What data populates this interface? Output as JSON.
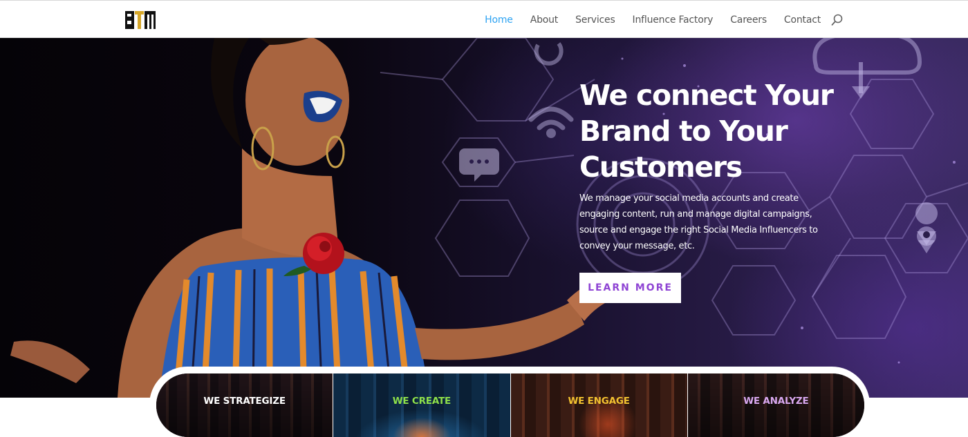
{
  "header": {
    "logo_text": "BTM",
    "nav": [
      {
        "label": "Home",
        "active": true
      },
      {
        "label": "About",
        "active": false
      },
      {
        "label": "Services",
        "active": false
      },
      {
        "label": "Influence Factory",
        "active": false
      },
      {
        "label": "Careers",
        "active": false
      },
      {
        "label": "Contact",
        "active": false
      }
    ],
    "search_icon": "search-icon",
    "active_color": "#2ea3f2"
  },
  "hero": {
    "title": "We connect Your Brand to Your Customers",
    "description": "We manage your social media accounts and create engaging content, run and manage digital campaigns, source and engage the right Social Media Influencers to convey your message, etc.",
    "cta_label": "LEARN MORE",
    "cta_color": "#8f45d4"
  },
  "features": [
    {
      "label": "WE STRATEGIZE",
      "color": "#ffffff"
    },
    {
      "label": "WE CREATE",
      "color": "#8ee04a"
    },
    {
      "label": "WE ENGAGE",
      "color": "#f2c230"
    },
    {
      "label": "WE ANALYZE",
      "color": "#d9a8f0"
    }
  ]
}
